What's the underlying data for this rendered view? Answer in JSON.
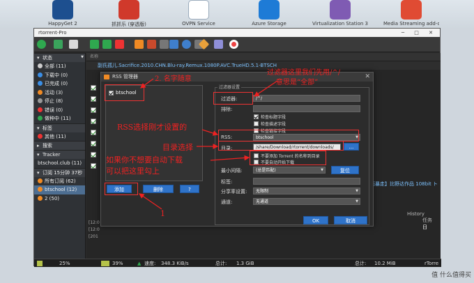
{
  "desktop": {
    "icons": [
      {
        "label": "HappyGet 2",
        "color": "#1d4f8f"
      },
      {
        "label": "抓抓乐 (穿透版)",
        "color": "#d0392b"
      },
      {
        "label": "OVPN Service",
        "color": "#ffffff"
      },
      {
        "label": "Azure Storage",
        "color": "#1e7bd6"
      },
      {
        "label": "Virtualization Station 3",
        "color": "#7f5bb3"
      },
      {
        "label": "Media Streaming add-on",
        "color": "#e04b33"
      }
    ]
  },
  "window": {
    "title": "rtorrent-Pro",
    "controls": "─ □ ✕"
  },
  "sidebar": {
    "sections": [
      {
        "title": "状态",
        "items": [
          {
            "label": "全部 (11)",
            "color": "#cccccc"
          },
          {
            "label": "下载中 (0)",
            "color": "#3a8ee6"
          },
          {
            "label": "已完成 (0)",
            "color": "#3a8ee6"
          },
          {
            "label": "活动 (3)",
            "color": "#f08a24"
          },
          {
            "label": "停止 (8)",
            "color": "#999999"
          },
          {
            "label": "错误 (0)",
            "color": "#e33"
          },
          {
            "label": "做种中 (11)",
            "color": "#2fa84f"
          }
        ]
      },
      {
        "title": "标签",
        "items": [
          {
            "label": "其他 (11)",
            "color": "#e33"
          }
        ]
      },
      {
        "title": "搜索",
        "items": []
      },
      {
        "title": "Tracker",
        "items": [
          {
            "label": "btschool.club (11)",
            "color": "#000000"
          }
        ]
      },
      {
        "title": "订阅 15分钟 37秒",
        "items": [
          {
            "label": "所有订阅 (62)",
            "color": "#f08a24"
          },
          {
            "label": "btschool (12)",
            "color": "#f08a24"
          },
          {
            "label": "2 (50)",
            "color": "#f08a24"
          }
        ]
      }
    ]
  },
  "main": {
    "column_header": "名称",
    "first_row": "副氏孤儿.Sacrifice.2010.CHN.Blu-ray.Remux.1080P.AVC.TrueHD.5.1-BTSCH",
    "right_text_1": "全面暴走】比野达作品 108bit ト",
    "tab_history": "History",
    "tab_tasks": "任务",
    "tab_log": "日",
    "log_lines": [
      "[12:0",
      "[12:0",
      "[201"
    ]
  },
  "statusbar": {
    "percent1": "25%",
    "percent2": "39%",
    "speed_label": "速度:",
    "speed_value": "348.3 KiB/s",
    "total_label": "总计:",
    "total_value": "1.3 GiB",
    "total2_label": "总计:",
    "total2_value": "10.2 MiB",
    "right_label": "rTorre"
  },
  "dialog": {
    "title": "RSS 管理器",
    "close": "✕",
    "feed_name": "btschool",
    "buttons": {
      "add": "添加",
      "delete": "删除",
      "help": "?"
    },
    "group_title": "过滤器设置",
    "filter_label": "过滤器:",
    "filter_value": "/^/",
    "exclude_label": "排除:",
    "check_title": "检查标题字段",
    "check_desc": "检查描述字段",
    "check_link": "检查链接字段",
    "rss_label": "RSS:",
    "rss_value": "btschool",
    "dir_label": "目录:",
    "dir_value": "/share/Download/rtorrent/downloads/",
    "dir_btn": "...",
    "no_add_name": "不要添加 Torrent 的名称到目录",
    "no_autostart": "不要自动开始下载",
    "min_interval_label": "最小间隔:",
    "min_interval_value": "(总是匹配)",
    "reset_btn": "复位",
    "tag_label": "标签:",
    "share_label": "分享率设置:",
    "share_value": "无限制",
    "channel_label": "通道:",
    "channel_value": "无通道",
    "ok": "OK",
    "cancel": "取消"
  },
  "annotations": {
    "a2": "2. 名字随意",
    "a_filter_1": "过滤器这里我们先用/^/",
    "a_filter_2": "意思是“全部”",
    "a_rss": "RSS选择刚才设置的",
    "a_dir": "目录选择",
    "a_auto_1": "如果你不想要自动下载",
    "a_auto_2": "可以把这里勾上",
    "a1": "1"
  },
  "watermark": "值 什么值得买"
}
